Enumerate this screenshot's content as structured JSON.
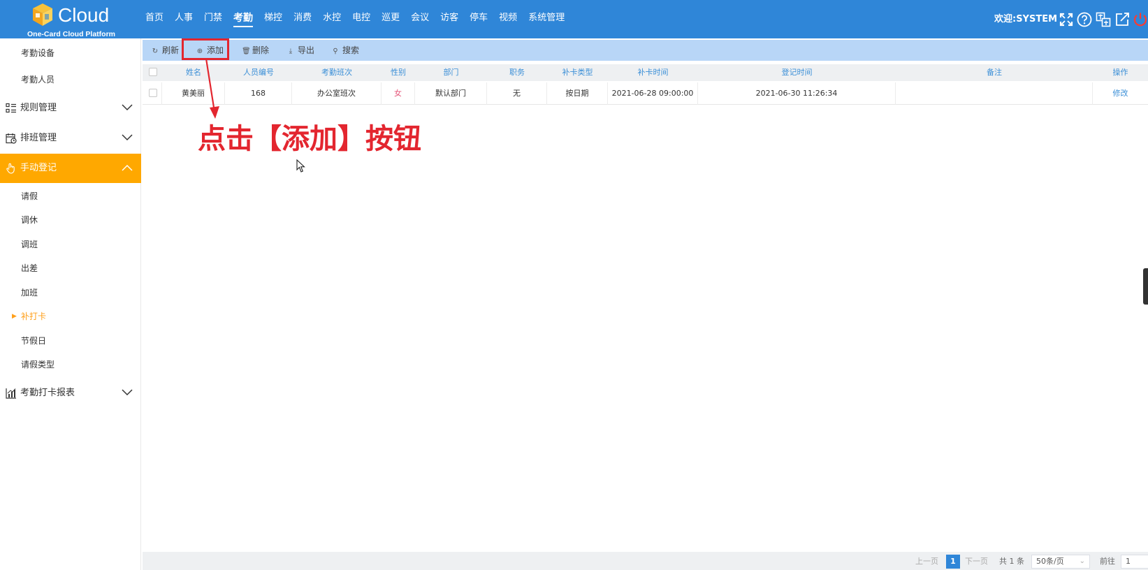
{
  "app": {
    "logo_text": "Cloud",
    "logo_subtitle": "One-Card Cloud Platform",
    "welcome": "欢迎:SYSTEM"
  },
  "nav": {
    "items": [
      "首页",
      "人事",
      "门禁",
      "考勤",
      "梯控",
      "消费",
      "水控",
      "电控",
      "巡更",
      "会议",
      "访客",
      "停车",
      "视频",
      "系统管理"
    ],
    "active": "考勤"
  },
  "header_icons": [
    "fullscreen-icon",
    "help-icon",
    "translate-icon",
    "external-link-icon",
    "power-icon"
  ],
  "sidebar": {
    "top_items": [
      "考勤设备",
      "考勤人员"
    ],
    "groups": [
      {
        "label": "规则管理",
        "icon": "list-rules-icon"
      },
      {
        "label": "排班管理",
        "icon": "calendar-schedule-icon"
      },
      {
        "label": "手动登记",
        "icon": "hand-pointer-icon"
      },
      {
        "label": "考勤打卡报表",
        "icon": "bar-chart-icon"
      }
    ],
    "manual_items": [
      "请假",
      "调休",
      "调班",
      "出差",
      "加班",
      "补打卡",
      "节假日",
      "请假类型"
    ],
    "active_item": "补打卡"
  },
  "toolbar": {
    "refresh": "刷新",
    "add": "添加",
    "delete": "删除",
    "export": "导出",
    "search": "搜索"
  },
  "table": {
    "headers": [
      "姓名",
      "人员编号",
      "考勤班次",
      "性别",
      "部门",
      "职务",
      "补卡类型",
      "补卡时间",
      "登记时间",
      "备注",
      "操作"
    ],
    "rows": [
      {
        "name": "黄美丽",
        "id": "168",
        "shift": "办公室班次",
        "gender": "女",
        "dept": "默认部门",
        "title": "无",
        "type": "按日期",
        "time": "2021-06-28 09:00:00",
        "reg_time": "2021-06-30 11:26:34",
        "note": "",
        "action": "修改"
      }
    ]
  },
  "annotation": "点击【添加】按钮",
  "pagination": {
    "prev": "上一页",
    "current": "1",
    "next": "下一页",
    "total": "共 1 条",
    "page_size": "50条/页",
    "goto_label": "前往",
    "goto_value": "1"
  },
  "colors": {
    "header_blue": "#2f86d8",
    "toolbar_blue": "#b8d6f7",
    "active_orange": "#ffa800",
    "annotation_red": "#e3262f"
  }
}
